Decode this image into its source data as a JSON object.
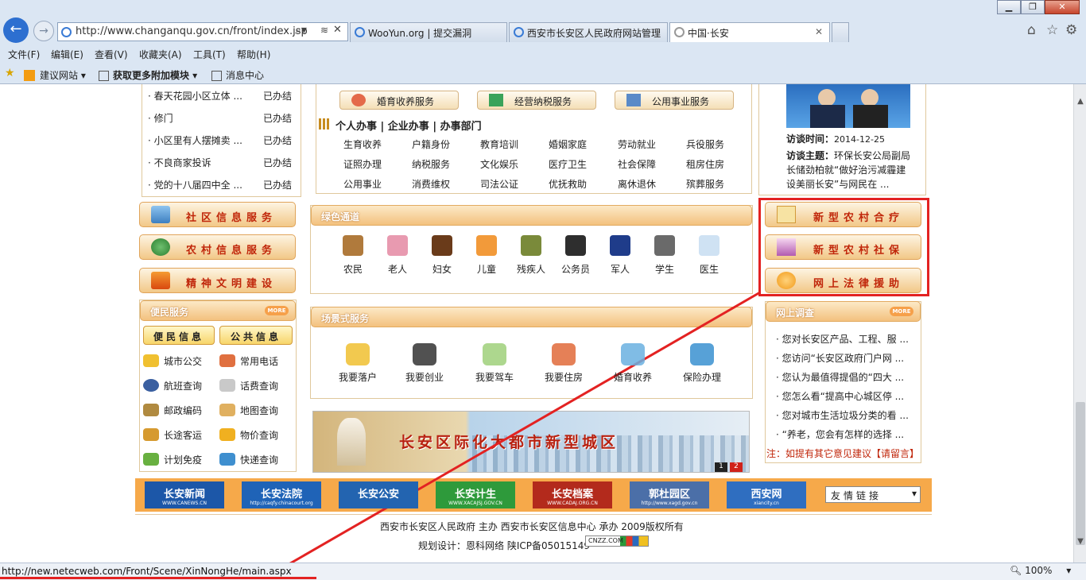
{
  "browser": {
    "address": "http://www.changanqu.gov.cn/front/index.jsp",
    "tabs": [
      {
        "label": "WooYun.org | 提交漏洞"
      },
      {
        "label": "西安市长安区人民政府网站管理"
      },
      {
        "label": "中国·长安"
      }
    ],
    "menu": [
      "文件(F)",
      "编辑(E)",
      "查看(V)",
      "收藏夹(A)",
      "工具(T)",
      "帮助(H)"
    ],
    "favorites": [
      "建议网站 ▾",
      "获取更多附加模块 ▾",
      "消息中心"
    ],
    "status_url": "http://new.netecweb.com/Front/Scene/XinNongHe/main.aspx",
    "zoom": "100%"
  },
  "left_list": [
    {
      "title": "春天花园小区立体 ...",
      "state": "已办结"
    },
    {
      "title": "修门",
      "state": "已办结"
    },
    {
      "title": "小区里有人摆摊卖 ...",
      "state": "已办结"
    },
    {
      "title": "不良商家投诉",
      "state": "已办结"
    },
    {
      "title": "党的十八届四中全 ...",
      "state": "已办结"
    }
  ],
  "left_buttons": [
    "社区信息服务",
    "农村信息服务",
    "精神文明建设"
  ],
  "convenience": {
    "title": "便民服务",
    "more": "MORE",
    "tabs": [
      "便民信息",
      "公共信息"
    ],
    "items": [
      "城市公交",
      "常用电话",
      "航班查询",
      "话费查询",
      "邮政编码",
      "地图查询",
      "长途客运",
      "物价查询",
      "计划免疫",
      "快递查询"
    ]
  },
  "services": {
    "buttons": [
      "婚育收养服务",
      "经营纳税服务",
      "公用事业服务"
    ],
    "heading": "个人办事 | 企业办事 | 办事部门",
    "items": [
      "生育收养",
      "户籍身份",
      "教育培训",
      "婚姻家庭",
      "劳动就业",
      "兵役服务",
      "证照办理",
      "纳税服务",
      "文化娱乐",
      "医疗卫生",
      "社会保障",
      "租房住房",
      "公用事业",
      "消费维权",
      "司法公证",
      "优抚救助",
      "离休退休",
      "殡葬服务"
    ]
  },
  "green": {
    "title": "绿色通道",
    "people": [
      "农民",
      "老人",
      "妇女",
      "儿童",
      "残疾人",
      "公务员",
      "军人",
      "学生",
      "医生"
    ]
  },
  "scene": {
    "title": "场景式服务",
    "items": [
      "我要落户",
      "我要创业",
      "我要驾车",
      "我要住房",
      "婚育收养",
      "保险办理"
    ]
  },
  "banner": {
    "text": "长安区际化大都市新型城区",
    "pages": [
      "1",
      "2"
    ]
  },
  "interview": {
    "date_label": "访谈时间：",
    "date": "2014-12-25",
    "topic_label": "访谈主题：",
    "topic": "环保长安公局副局长储劲柏就“做好治污减霾建设美丽长安”与网民在 ..."
  },
  "right_buttons": [
    "新型农村合疗",
    "新型农村社保",
    "网上法律援助"
  ],
  "survey": {
    "title": "网上调查",
    "more": "MORE",
    "items": [
      "您对长安区产品、工程、服 ...",
      "您访问“长安区政府门户网 ...",
      "您认为最值得提倡的“四大 ...",
      "您怎么看“提高中心城区停 ...",
      "您对城市生活垃圾分类的看 ...",
      "“养老，您会有怎样的选择 ..."
    ],
    "note": "注：如提有其它意见建议【请留言】"
  },
  "logos": [
    {
      "name": "长安新闻",
      "sub": "WWW.CANEWS.CN",
      "color": "#1c57a8"
    },
    {
      "name": "长安法院",
      "sub": "http://caqfy.chinacourt.org",
      "color": "#1f63b7"
    },
    {
      "name": "长安公安",
      "sub": "",
      "color": "#2364b0"
    },
    {
      "name": "长安计生",
      "sub": "WWW.XACAJSJ.GOV.CN",
      "color": "#2e9a3b"
    },
    {
      "name": "长安档案",
      "sub": "WWW.CADAJ.ORG.CN",
      "color": "#b32a1c"
    },
    {
      "name": "郭杜园区",
      "sub": "http://www.xagd.gov.cn",
      "color": "#4b6fa8"
    },
    {
      "name": "西安网",
      "sub": "xiancity.cn",
      "color": "#2f6ec0"
    }
  ],
  "friend_links": "友情链接",
  "footer": {
    "line1": "西安市长安区人民政府 主办 西安市长安区信息中心 承办 2009版权所有",
    "line2": "规划设计：恩科网络 陕ICP备05015149",
    "badge": "CNZZ.COM"
  }
}
